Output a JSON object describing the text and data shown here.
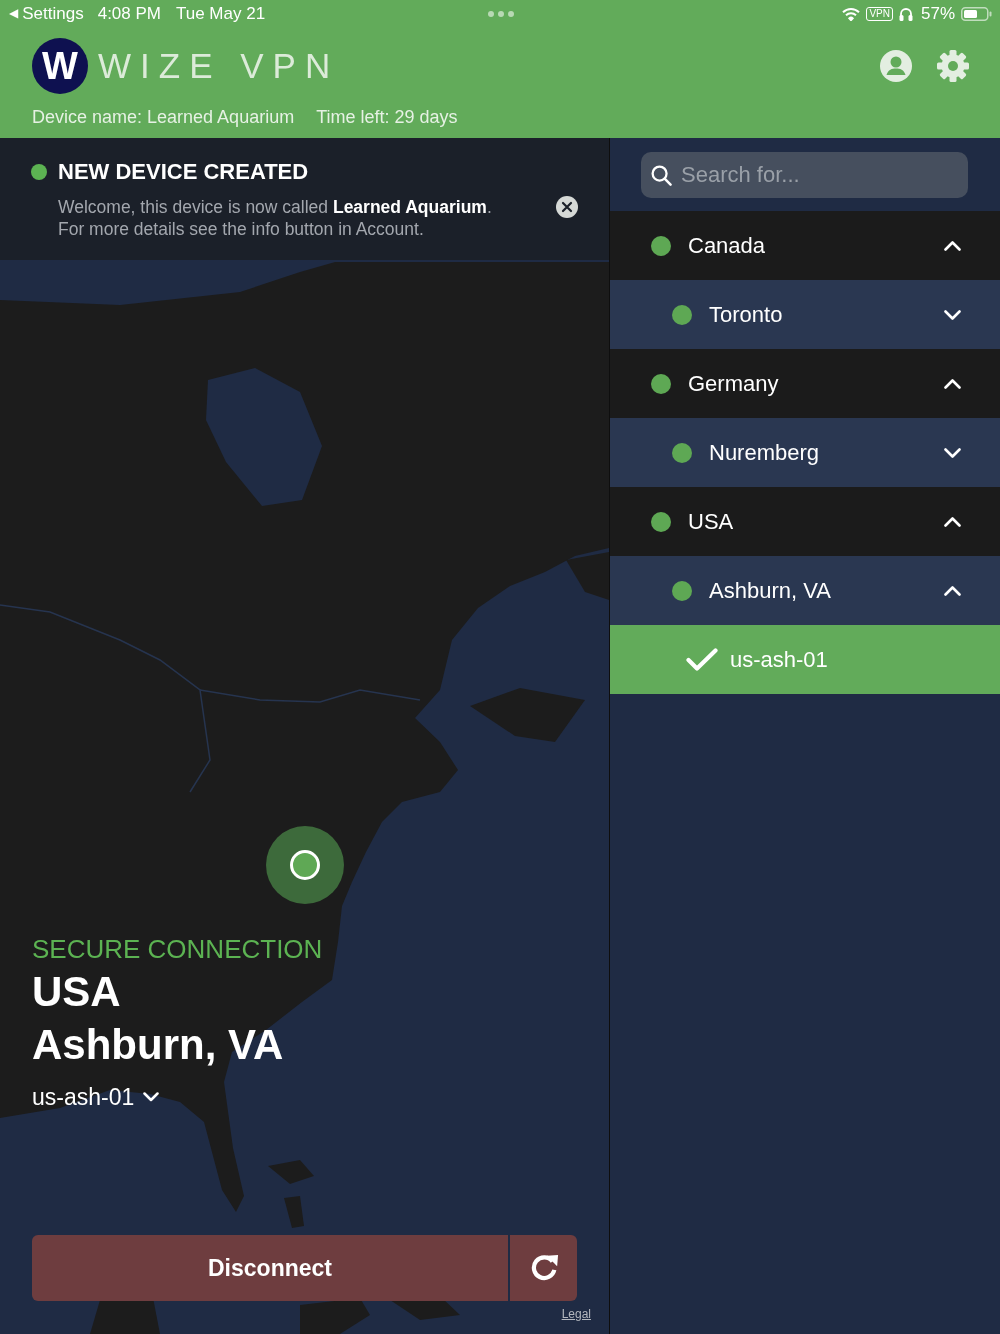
{
  "status_bar": {
    "back_arrow": "◀",
    "back_label": "Settings",
    "time": "4:08 PM",
    "date": "Tue May 21",
    "vpn_badge": "VPN",
    "battery": "57%"
  },
  "header": {
    "logo_letter": "W",
    "brand": "WIZE VPN",
    "device_name": "Device name: Learned Aquarium",
    "time_left": "Time left: 29 days"
  },
  "notification": {
    "title": "NEW DEVICE CREATED",
    "message": "Welcome, this device is now called **Learned Aquarium**.\nFor more details see the info button in Account."
  },
  "connection": {
    "status": "SECURE CONNECTION",
    "country": "USA",
    "city": "Ashburn, VA",
    "server": "us-ash-01"
  },
  "actions": {
    "disconnect": "Disconnect",
    "legal": "Legal"
  },
  "search": {
    "placeholder": "Search for..."
  },
  "locations": [
    {
      "kind": "country",
      "name": "Canada",
      "expanded": true,
      "children": [
        {
          "kind": "city",
          "name": "Toronto",
          "expanded": false
        }
      ]
    },
    {
      "kind": "country",
      "name": "Germany",
      "expanded": true,
      "children": [
        {
          "kind": "city",
          "name": "Nuremberg",
          "expanded": false
        }
      ]
    },
    {
      "kind": "country",
      "name": "USA",
      "expanded": true,
      "children": [
        {
          "kind": "city",
          "name": "Ashburn, VA",
          "expanded": true,
          "children": [
            {
              "kind": "server",
              "name": "us-ash-01",
              "selected": true
            }
          ]
        }
      ]
    }
  ]
}
